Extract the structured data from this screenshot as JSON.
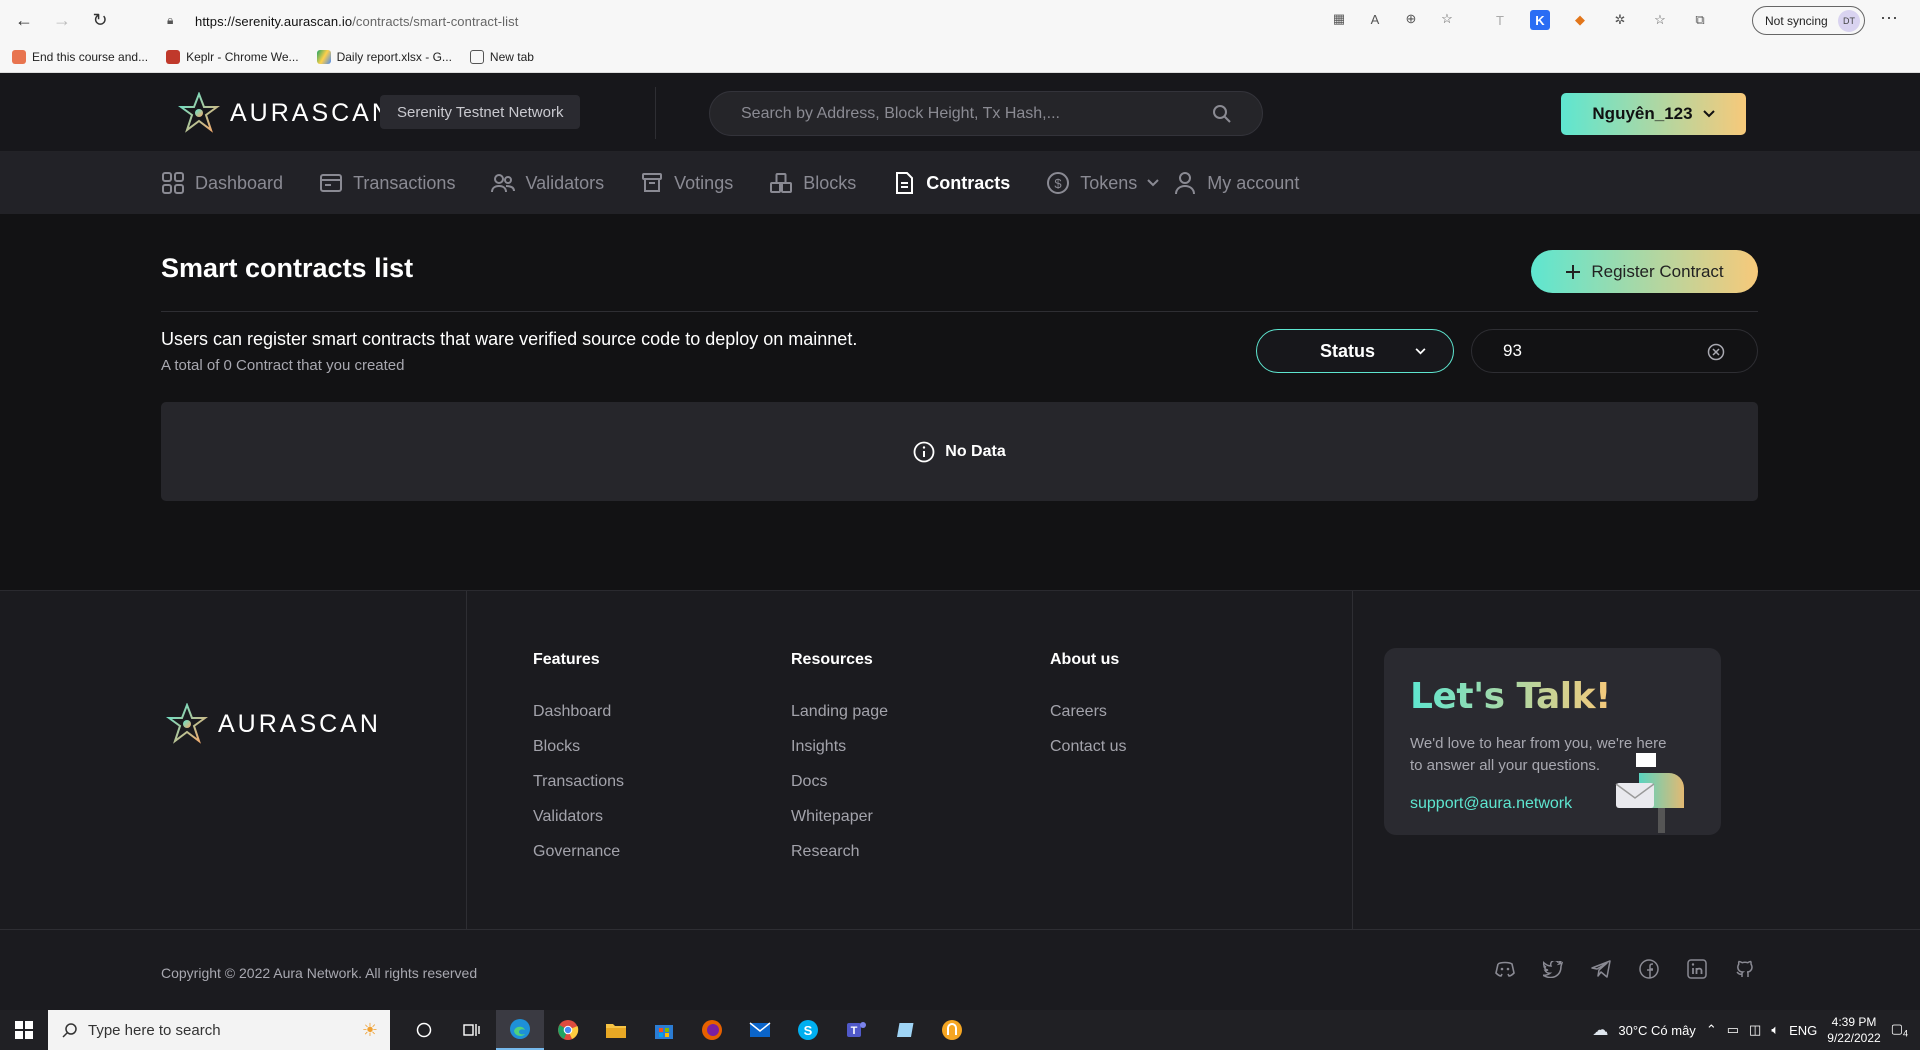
{
  "browser": {
    "url_host": "https://serenity.aurascan.io",
    "url_path": "/contracts/smart-contract-list",
    "sync_label": "Not syncing",
    "avatar_initials": "DT",
    "bookmarks": [
      {
        "label": "End this course and...",
        "color": "#e8744f"
      },
      {
        "label": "Keplr - Chrome We...",
        "color": "#c0392b"
      },
      {
        "label": "Daily report.xlsx - G...",
        "color": "#1fa463"
      },
      {
        "label": "New tab",
        "color": "#555555"
      }
    ]
  },
  "header": {
    "logo_text": "AURASCAN",
    "network": "Serenity Testnet Network",
    "search_placeholder": "Search by Address, Block Height, Tx Hash,...",
    "user_name": "Nguyên_123"
  },
  "nav": {
    "items": [
      {
        "label": "Dashboard",
        "icon": "dashboard-icon"
      },
      {
        "label": "Transactions",
        "icon": "transactions-icon"
      },
      {
        "label": "Validators",
        "icon": "validators-icon"
      },
      {
        "label": "Votings",
        "icon": "votings-icon"
      },
      {
        "label": "Blocks",
        "icon": "blocks-icon"
      },
      {
        "label": "Contracts",
        "icon": "contracts-icon",
        "active": true
      },
      {
        "label": "Tokens",
        "icon": "tokens-icon"
      },
      {
        "label": "My account",
        "icon": "account-icon"
      }
    ]
  },
  "main": {
    "title": "Smart contracts list",
    "register_label": "Register Contract",
    "description": "Users can register smart contracts that ware verified source code to deploy on mainnet.",
    "sub_description": "A total of 0 Contract that you created",
    "status_label": "Status",
    "filter_value": "93",
    "no_data": "No Data"
  },
  "footer": {
    "logo_text": "AURASCAN",
    "features_title": "Features",
    "features": [
      "Dashboard",
      "Blocks",
      "Transactions",
      "Validators",
      "Governance"
    ],
    "resources_title": "Resources",
    "resources": [
      "Landing page",
      "Insights",
      "Docs",
      "Whitepaper",
      "Research"
    ],
    "about_title": "About us",
    "about": [
      "Careers",
      "Contact us"
    ],
    "talk_title": "Let's Talk!",
    "talk_text": "We'd love to hear from you, we're here to answer all your questions.",
    "talk_email": "support@aura.network",
    "copyright": "Copyright © 2022 Aura Network. All rights reserved"
  },
  "taskbar": {
    "search_placeholder": "Type here to search",
    "weather": "30°C  Có mây",
    "lang": "ENG",
    "time": "4:39 PM",
    "date": "9/22/2022",
    "notif_count": "4"
  },
  "colors": {
    "accent_teal": "#5ee6d0",
    "accent_gold": "#f7c97a",
    "bg": "#121214"
  }
}
